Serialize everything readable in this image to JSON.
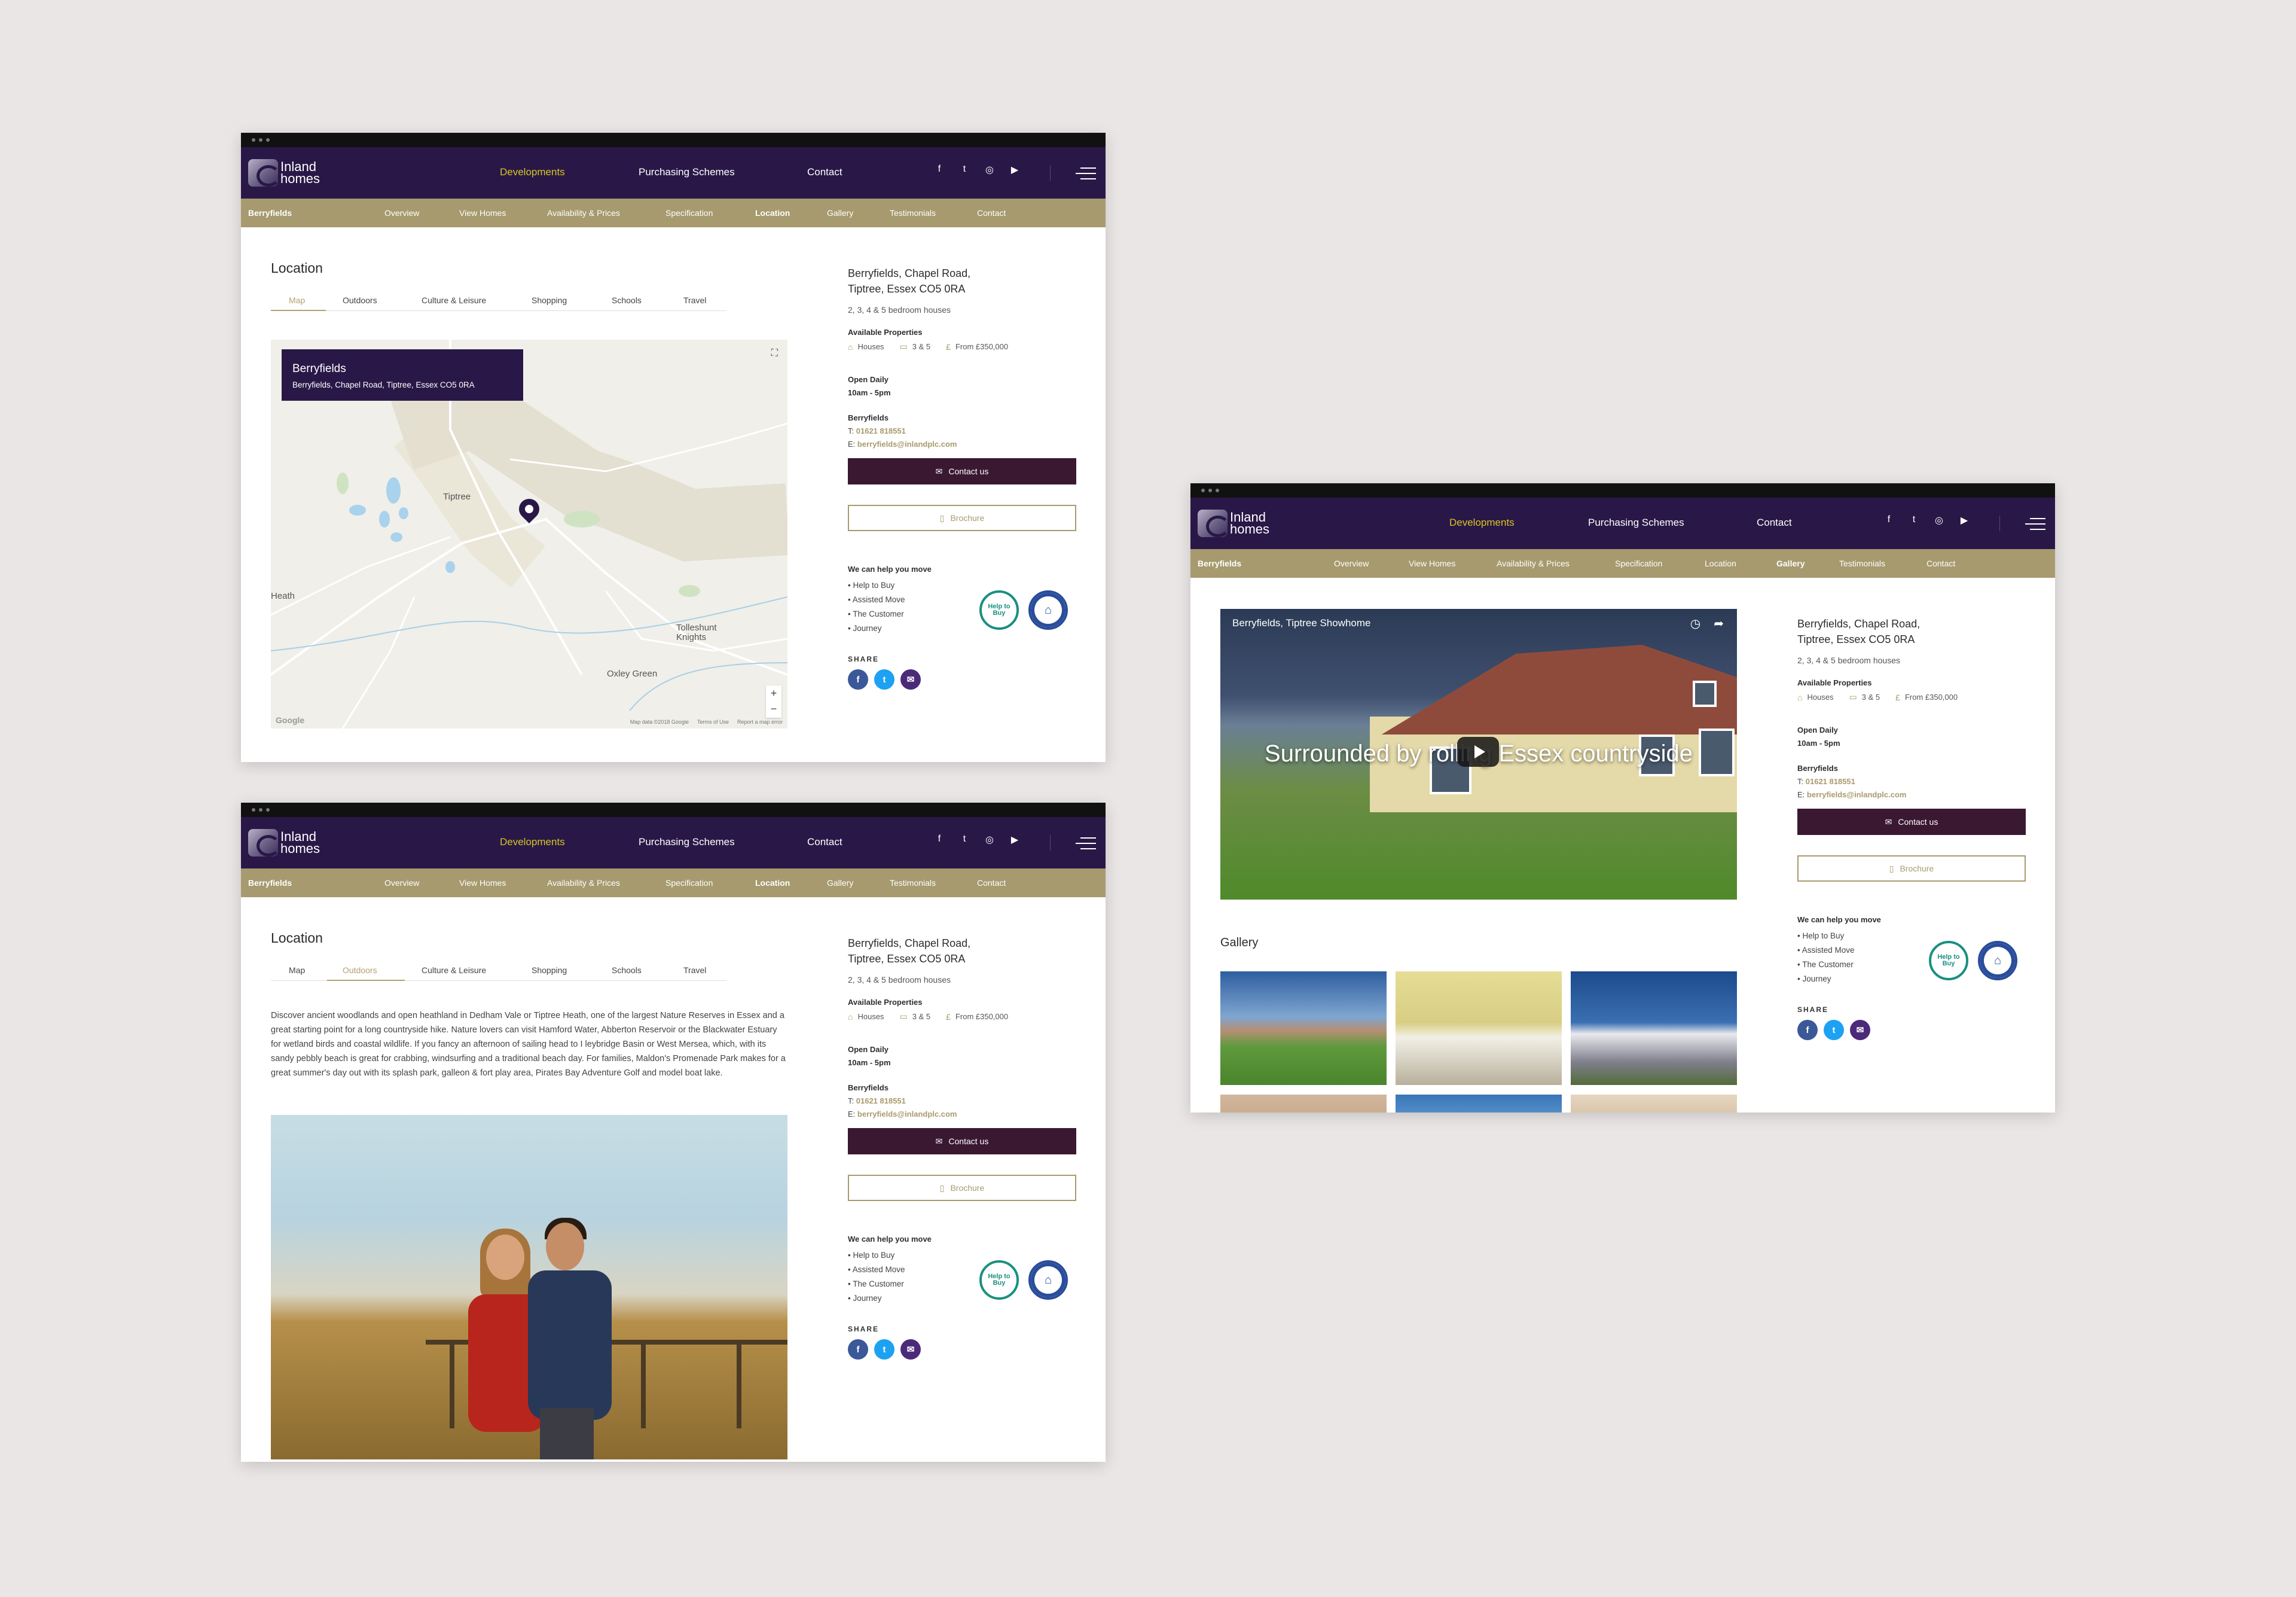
{
  "brand": {
    "logo_line1": "Inland",
    "logo_line2": "homes"
  },
  "nav": {
    "developments": "Developments",
    "purchasing": "Purchasing Schemes",
    "contact": "Contact"
  },
  "social": {
    "facebook": "f",
    "twitter": "t",
    "instagram": "◎",
    "youtube": "▶"
  },
  "subnav": {
    "development": "Berryfields",
    "items": [
      "Overview",
      "View Homes",
      "Availability & Prices",
      "Specification",
      "Location",
      "Gallery",
      "Testimonials",
      "Contact"
    ]
  },
  "location": {
    "title": "Location",
    "tabs": [
      "Map",
      "Outdoors",
      "Culture & Leisure",
      "Shopping",
      "Schools",
      "Travel"
    ]
  },
  "map": {
    "card_title": "Berryfields",
    "card_address": "Berryfields, Chapel Road, Tiptree, Essex CO5 0RA",
    "places": [
      "Tiptree",
      "Heath",
      "Tolleshunt Knights",
      "Oxley Green"
    ],
    "zoom_in": "+",
    "zoom_out": "−",
    "google": "Google",
    "footer": [
      "Map data ©2018 Google",
      "Terms of Use",
      "Report a map error"
    ]
  },
  "outdoors_text": "Discover ancient woodlands and open heathland in Dedham Vale or Tiptree Heath, one of the largest Nature Reserves in Essex and a great starting point for a long countryside hike. Nature lovers can visit Hamford Water, Abberton Reservoir or the Blackwater Estuary for wetland birds and coastal wildlife. If you fancy an afternoon of sailing head to I leybridge Basin or West Mersea, which, with its sandy pebbly beach is great for crabbing, windsurfing and a traditional beach day. For families, Maldon's Promenade Park makes for a great summer's day out with its splash park, galleon & fort play area, Pirates Bay Adventure Golf and model boat lake.",
  "sidebar": {
    "address_line1": "Berryfields, Chapel Road,",
    "address_line2": "Tiptree, Essex CO5 0RA",
    "bedrooms": "2, 3, 4 & 5 bedroom houses",
    "available_heading": "Available Properties",
    "prop_type": "Houses",
    "prop_beds": "3 & 5",
    "prop_price": "From £350,000",
    "open_heading": "Open Daily",
    "open_hours": "10am - 5pm",
    "contact_name": "Berryfields",
    "tel_label": "T:",
    "tel": "01621 818551",
    "email_label": "E:",
    "email": "berryfields@inlandplc.com",
    "contact_button": "Contact us",
    "brochure_button": "Brochure",
    "help_heading": "We can help you move",
    "help_items": [
      "Help to Buy",
      "Assisted Move",
      "The Customer",
      "Journey"
    ],
    "badge1": "Help to Buy",
    "share_label": "SHARE"
  },
  "gallery": {
    "video_title": "Berryfields, Tiptree Showhome",
    "video_caption": "Surrounded by rolling Essex countryside",
    "title": "Gallery"
  },
  "colors": {
    "nav": "#291847",
    "subnav": "#a69a6e",
    "accent": "#d8c421",
    "button": "#3a1832",
    "gold": "#a89b6e"
  }
}
